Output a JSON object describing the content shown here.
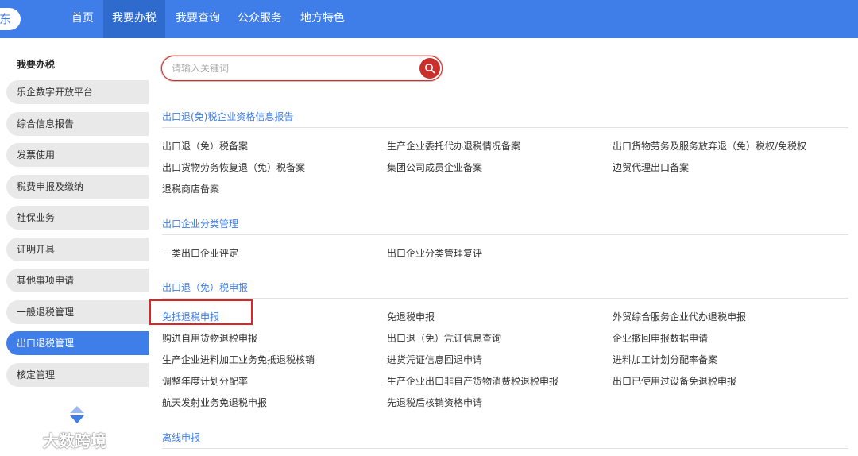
{
  "nav": {
    "logo_text": "东",
    "items": [
      {
        "label": "首页",
        "active": false
      },
      {
        "label": "我要办税",
        "active": true
      },
      {
        "label": "我要查询",
        "active": false
      },
      {
        "label": "公众服务",
        "active": false
      },
      {
        "label": "地方特色",
        "active": false
      }
    ]
  },
  "sidebar": {
    "heading": "我要办税",
    "items": [
      {
        "label": "乐企数字开放平台"
      },
      {
        "label": "综合信息报告"
      },
      {
        "label": "发票使用"
      },
      {
        "label": "税费申报及缴纳"
      },
      {
        "label": "社保业务"
      },
      {
        "label": "证明开具"
      },
      {
        "label": "其他事项申请"
      },
      {
        "label": "一般退税管理"
      },
      {
        "label": "出口退税管理",
        "active": true
      },
      {
        "label": "核定管理"
      }
    ]
  },
  "watermark": {
    "text": "大数跨境"
  },
  "search": {
    "placeholder": "请输入关键词",
    "value": ""
  },
  "sections": [
    {
      "title": "出口退(免)税企业资格信息报告",
      "rows": [
        [
          "出口退（免）税备案",
          "生产企业委托代办退税情况备案",
          "出口货物劳务及服务放弃退（免）税权/免税权"
        ],
        [
          "出口货物劳务恢复退（免）税备案",
          "集团公司成员企业备案",
          "边贸代理出口备案"
        ],
        [
          "退税商店备案"
        ]
      ]
    },
    {
      "title": "出口企业分类管理",
      "rows": [
        [
          "一类出口企业评定",
          "出口企业分类管理复评"
        ]
      ]
    },
    {
      "title": "出口退（免）税申报",
      "rows": [
        [
          "免抵退税申报",
          "免退税申报",
          "外贸综合服务企业代办退税申报"
        ],
        [
          "购进自用货物退税申报",
          "出口退（免）凭证信息查询",
          "企业撤回申报数据申请"
        ],
        [
          "生产企业进料加工业务免抵退税核销",
          "进货凭证信息回退申请",
          "进料加工计划分配率备案"
        ],
        [
          "调整年度计划分配率",
          "生产企业出口非自产货物消费税退税申报",
          "出口已使用过设备免退税申报"
        ],
        [
          "航天发射业务免退税申报",
          "先退税后核销资格申请"
        ]
      ]
    },
    {
      "title": "离线申报",
      "rows": []
    }
  ]
}
